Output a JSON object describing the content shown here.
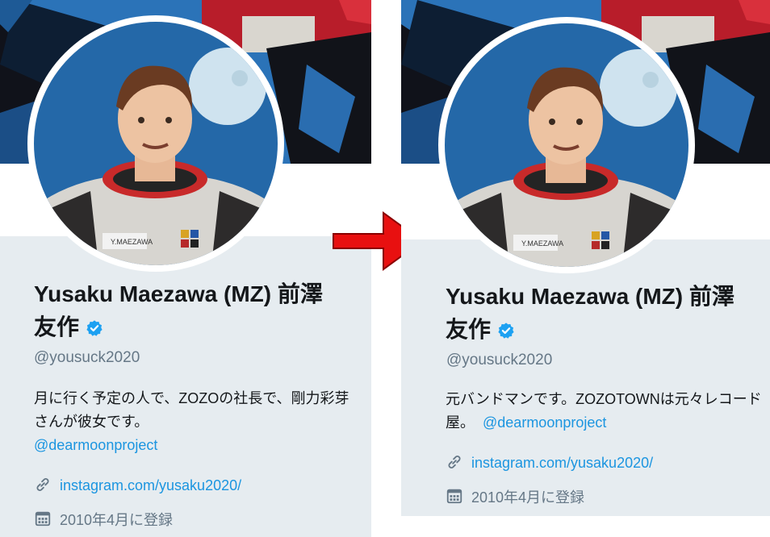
{
  "colors": {
    "link": "#1b95e0",
    "muted": "#657786",
    "panel": "#e6ecf0",
    "arrow": "#e81010"
  },
  "before": {
    "display_name": "Yusaku Maezawa (MZ) 前澤友作",
    "handle": "@yousuck2020",
    "bio_text": "月に行く予定の人で、ZOZOの社長で、剛力彩芽さんが彼女です。",
    "bio_mention": "@dearmoonproject",
    "link": "instagram.com/yusaku2020/",
    "joined": "2010年4月に登録"
  },
  "after": {
    "display_name": "Yusaku Maezawa (MZ) 前澤友作",
    "handle": "@yousuck2020",
    "bio_text": "元バンドマンです。ZOZOTOWNは元々レコード屋。",
    "bio_mention": "@dearmoonproject",
    "link": "instagram.com/yusaku2020/",
    "joined": "2010年4月に登録"
  },
  "icons": {
    "verified": "verified-badge-icon",
    "link": "link-icon",
    "calendar": "calendar-icon",
    "arrow": "right-arrow-icon"
  }
}
